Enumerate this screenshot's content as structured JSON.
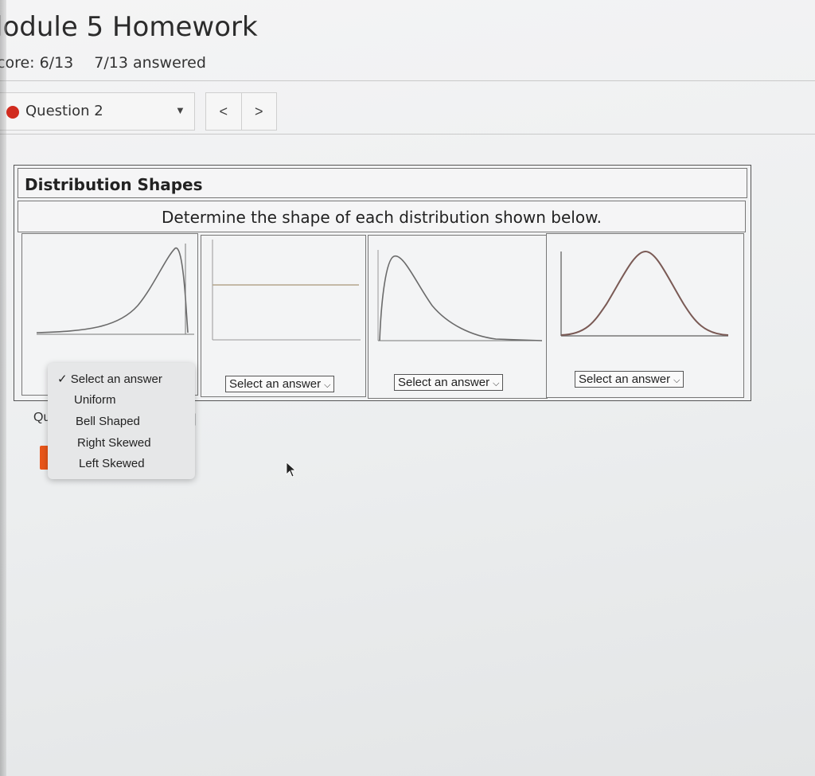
{
  "header": {
    "title": "lodule 5 Homework",
    "score": "core: 6/13",
    "answered": "7/13 answered"
  },
  "question_nav": {
    "label": "Question 2",
    "prev": "<",
    "next": ">"
  },
  "question": {
    "heading": "Distribution Shapes",
    "instruction": "Determine the shape of each distribution shown below."
  },
  "dropdowns": [
    "Select an answer",
    "Select an answer",
    "Select an answer",
    "Select an answer"
  ],
  "dropdown_menu": {
    "check": "✓",
    "options": [
      "Select an answer",
      "Uniform",
      "Bell Shaped",
      "Right Skewed",
      "Left Skewed"
    ],
    "selected_index": 0
  },
  "obscured": {
    "qu_text": "Qu",
    "bracket": "]"
  },
  "icons": {
    "status": "red-dot-icon",
    "caret": "caret-down-icon",
    "cursor": "mouse-pointer-icon"
  },
  "colors": {
    "status_dot": "#d12c1f",
    "submit_button": "#e8561a",
    "curve": "#6b6b6b"
  }
}
